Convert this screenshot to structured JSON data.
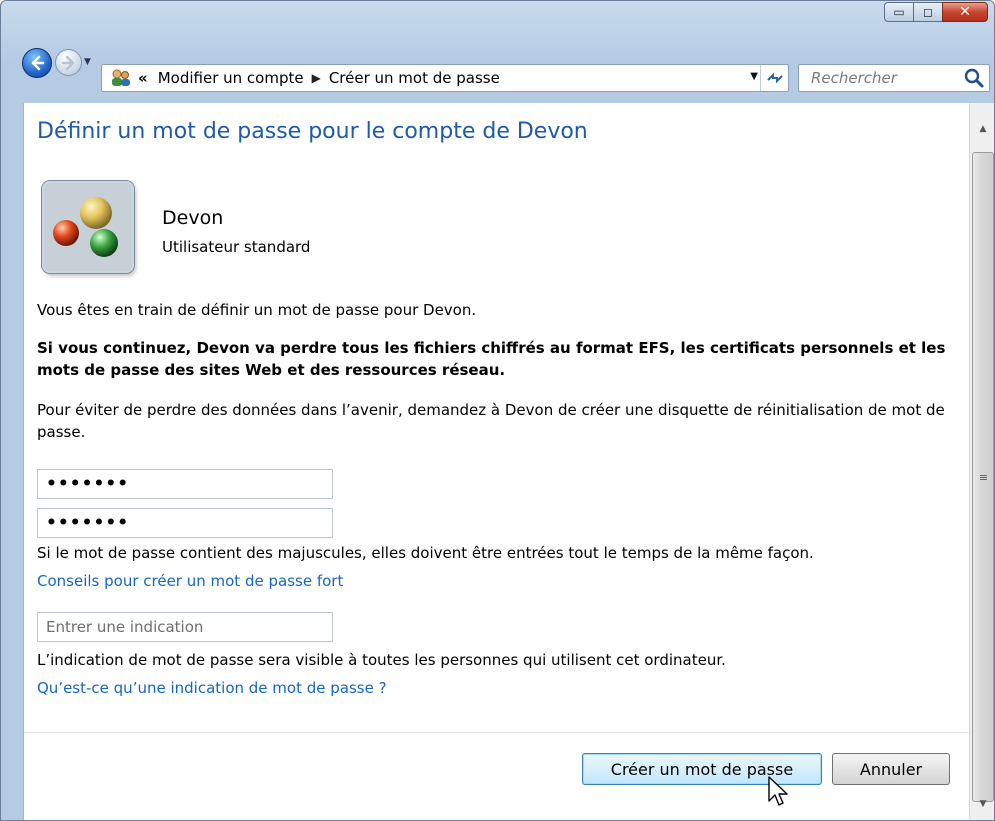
{
  "window": {
    "caption_buttons": {
      "minimize": "▭",
      "maximize": "◻",
      "close": "✕"
    }
  },
  "nav": {
    "breadcrumb_prefix": "«",
    "crumbs": [
      "Modifier un compte",
      "Créer un mot de passe"
    ],
    "search_placeholder": "Rechercher"
  },
  "page": {
    "title": "Définir un mot de passe pour le compte de Devon",
    "user_name": "Devon",
    "user_type": "Utilisateur standard",
    "intro": "Vous êtes en train de définir un mot de passe pour Devon.",
    "warning": "Si vous continuez, Devon va perdre tous les fichiers chiffrés au format EFS, les certificats personnels et les mots de passe des sites Web et des ressources réseau.",
    "advice": "Pour éviter de perdre des données dans l’avenir, demandez à Devon de créer une disquette de réinitialisation de mot de passe.",
    "password_value": "•••••••",
    "confirm_value": "•••••••",
    "case_note": "Si le mot de passe contient des majuscules, elles doivent être entrées tout le temps de la même façon.",
    "tips_link": "Conseils pour créer un mot de passe fort",
    "hint_placeholder": "Entrer une indication",
    "hint_note": "L’indication de mot de passe sera visible à toutes les personnes qui utilisent cet ordinateur.",
    "hint_link": "Qu’est-ce qu’une indication de mot de passe ?"
  },
  "buttons": {
    "create": "Créer un mot de passe",
    "cancel": "Annuler"
  },
  "colors": {
    "title_blue": "#1e5aa8",
    "link_blue": "#1666c4"
  }
}
